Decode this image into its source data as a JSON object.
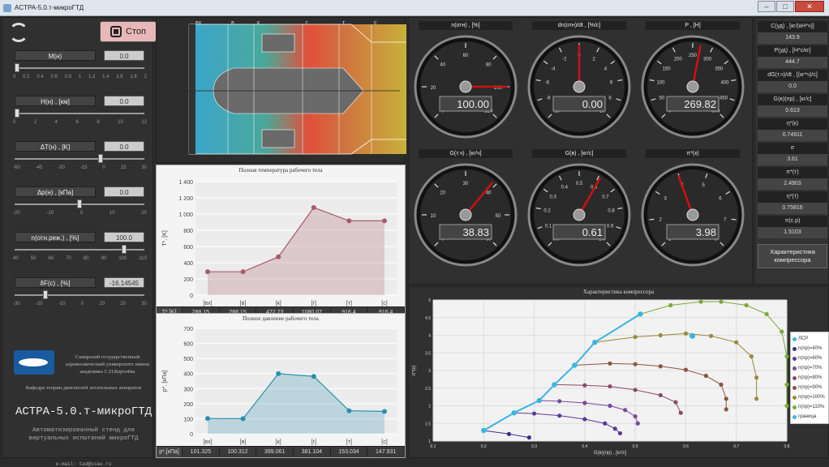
{
  "window": {
    "title": "ACTPA-5.0.т-микроГТД",
    "min": "–",
    "max": "□",
    "close": "✕"
  },
  "controls": {
    "stop_label": "Стоп"
  },
  "params": [
    {
      "label": "M(н)",
      "value": "0.0",
      "ticks": [
        "0",
        "0.2",
        "0.4",
        "0.6",
        "0.8",
        "1",
        "1.2",
        "1.4",
        "1.6",
        "1.8",
        "2"
      ],
      "pos": 0.0
    },
    {
      "label": "H(н) , [км]",
      "value": "0.0",
      "ticks": [
        "0",
        "2",
        "4",
        "6",
        "8",
        "10",
        "12"
      ],
      "pos": 0.0
    },
    {
      "label": "ΔT(н) , [K]",
      "value": "0.0",
      "ticks": [
        "-60",
        "-45",
        "-30",
        "-15",
        "0",
        "15",
        "30"
      ],
      "pos": 0.667
    },
    {
      "label": "Δp(н) , [кПа]",
      "value": "0.0",
      "ticks": [
        "-20",
        "-10",
        "0",
        "10",
        "20"
      ],
      "pos": 0.5
    },
    {
      "label": "n(отн.реж.) , [%]",
      "value": "100.0",
      "ticks": [
        "40",
        "50",
        "60",
        "70",
        "80",
        "90",
        "100",
        "110"
      ],
      "pos": 0.857
    },
    {
      "label": "δF(с) , [%]",
      "value": "-16.14545",
      "ticks": [
        "-30",
        "-20",
        "-10",
        "0",
        "10",
        "20",
        "30"
      ],
      "pos": 0.23
    }
  ],
  "branding": {
    "university": "Самарский государственный аэрокосмический университет имени академика С.П.Королёва",
    "department": "Кафедра теории двигателей летательных аппаратов",
    "app": "АСТРА-5.0.т-микроГТД",
    "description": "Автоматизированный стенд для виртуальных испытаний микроГТД",
    "email": "e-mail: tad@ssau.ru"
  },
  "engine": {
    "stations": [
      "вх",
      "в",
      "к",
      "г",
      "т",
      "с"
    ]
  },
  "temp_chart": {
    "title": "Полная температура рабочего тела",
    "row_label": "T*,[K]",
    "ylabel": "T*, [K]",
    "ylim": [
      0,
      1400
    ],
    "yticks": [
      "0",
      "200",
      "400",
      "600",
      "800",
      "1 000",
      "1 200",
      "1 400"
    ],
    "categories": [
      "[вх]",
      "[в]",
      "[к]",
      "[г]",
      "[т]",
      "[с]"
    ],
    "values": [
      288.15,
      288.15,
      472.73,
      1080.07,
      916.4,
      916.4
    ],
    "display": [
      "288.15",
      "288.15",
      "472.73",
      "1080.07",
      "916.4",
      "916.4"
    ],
    "color": "#a85a6a"
  },
  "press_chart": {
    "title": "Полное давление рабочего тела",
    "row_label": "p*,[кПа]",
    "ylabel": "p*, [кПа]",
    "ylim": [
      0,
      700
    ],
    "yticks": [
      "0",
      "100",
      "200",
      "300",
      "400",
      "500",
      "600",
      "700"
    ],
    "categories": [
      "[вх]",
      "[в]",
      "[к]",
      "[г]",
      "[т]",
      "[с]"
    ],
    "values": [
      101.325,
      100.312,
      399.061,
      381.104,
      153.034,
      147.931
    ],
    "display": [
      "101.325",
      "100.312",
      "399.061",
      "381.104",
      "153.034",
      "147.931"
    ],
    "color": "#2a8fb0"
  },
  "gauges": [
    {
      "label": "n(отн) , [%]",
      "value": "100.00",
      "min": 0,
      "max": 120,
      "v": 100,
      "ticks": [
        "0",
        "20",
        "40",
        "60",
        "80",
        "100",
        "120"
      ]
    },
    {
      "label": "dn(отн)/dt , [%/c]",
      "value": "0.00",
      "min": -10,
      "max": 10,
      "v": 0,
      "ticks": [
        "-10",
        "-8",
        "-6",
        "-4",
        "-2",
        "0",
        "2",
        "4",
        "6",
        "8",
        "10"
      ]
    },
    {
      "label": "P , [H]",
      "value": "269.82",
      "min": 0,
      "max": 500,
      "v": 269.82,
      "ticks": [
        "0",
        "50",
        "100",
        "150",
        "200",
        "250",
        "300",
        "350",
        "400",
        "450",
        "500"
      ]
    },
    {
      "label": "G(т.ч) , [кг/ч]",
      "value": "38.83",
      "min": 0,
      "max": 60,
      "v": 38.83,
      "ticks": [
        "0",
        "10",
        "20",
        "30",
        "40",
        "50",
        "60"
      ]
    },
    {
      "label": "G(в) , [кг/с]",
      "value": "0.61",
      "min": 0,
      "max": 1,
      "v": 0.61,
      "ticks": [
        "0.0",
        "0.1",
        "0.2",
        "0.3",
        "0.4",
        "0.5",
        "0.6",
        "0.7",
        "0.8",
        "0.9",
        "1.0"
      ]
    },
    {
      "label": "π*(к)",
      "value": "3.98",
      "min": 1,
      "max": 8,
      "v": 3.98,
      "ticks": [
        "1",
        "2",
        "3",
        "4",
        "5",
        "6",
        "7",
        "8"
      ]
    }
  ],
  "right_params": [
    {
      "label": "C(уд) , [кг/(кН*ч)]",
      "value": "143.9"
    },
    {
      "label": "P(уд) , [Н*с/кг]",
      "value": "444.7"
    },
    {
      "label": "dG(т.ч)/dt , [(кг*ч)/c]",
      "value": "0.0"
    },
    {
      "label": "G(в)(пр) , [кг/с]",
      "value": "0.613"
    },
    {
      "label": "η*(к)",
      "value": "0.74911"
    },
    {
      "label": "σ",
      "value": "3.61"
    },
    {
      "label": "π*(т)",
      "value": "2.4903"
    },
    {
      "label": "η*(т)",
      "value": "0.75816"
    },
    {
      "label": "π(с.р)",
      "value": "1.5103"
    }
  ],
  "char_button": "Характеристика компрессора",
  "map": {
    "title": "Характеристика компрессора",
    "xlabel": "G(в)(пр) , [кг/с]",
    "ylabel": "π*(к)",
    "xticks": [
      "0.1",
      "0.2",
      "0.3",
      "0.4",
      "0.5",
      "0.6",
      "0.7",
      "0.8"
    ],
    "yticks": [
      "1",
      "1.5",
      "2",
      "2.5",
      "3",
      "3.5",
      "4",
      "4.5",
      "5"
    ],
    "legend": [
      {
        "name": "ЛСР",
        "color": "#39b5e0"
      },
      {
        "name": "n(пр)=40%",
        "color": "#3b2f8c"
      },
      {
        "name": "n(пр)=60%",
        "color": "#5b3a9a"
      },
      {
        "name": "n(пр)=70%",
        "color": "#7a4b9a"
      },
      {
        "name": "n(пр)=80%",
        "color": "#8c4a6a"
      },
      {
        "name": "n(пр)=90%",
        "color": "#8a5540"
      },
      {
        "name": "n(пр)=100%",
        "color": "#9a8a3a"
      },
      {
        "name": "n(пр)=110%",
        "color": "#7aaa3a"
      },
      {
        "name": "граница",
        "color": "#39b5e0"
      }
    ],
    "chart_data": {
      "type": "scatter",
      "xlim": [
        0.1,
        0.8
      ],
      "ylim": [
        1,
        5
      ],
      "series": [
        {
          "name": "n(пр)=40%",
          "points": [
            [
              0.2,
              1.3
            ],
            [
              0.25,
              1.2
            ],
            [
              0.29,
              1.1
            ]
          ]
        },
        {
          "name": "n(пр)=60%",
          "points": [
            [
              0.26,
              1.8
            ],
            [
              0.3,
              1.78
            ],
            [
              0.35,
              1.72
            ],
            [
              0.4,
              1.62
            ],
            [
              0.44,
              1.5
            ],
            [
              0.46,
              1.35
            ],
            [
              0.47,
              1.22
            ]
          ]
        },
        {
          "name": "n(пр)=70%",
          "points": [
            [
              0.31,
              2.15
            ],
            [
              0.35,
              2.13
            ],
            [
              0.4,
              2.08
            ],
            [
              0.45,
              2.0
            ],
            [
              0.48,
              1.88
            ],
            [
              0.5,
              1.7
            ],
            [
              0.505,
              1.5
            ]
          ]
        },
        {
          "name": "n(пр)=80%",
          "points": [
            [
              0.34,
              2.6
            ],
            [
              0.4,
              2.58
            ],
            [
              0.45,
              2.55
            ],
            [
              0.5,
              2.45
            ],
            [
              0.55,
              2.3
            ],
            [
              0.58,
              2.1
            ],
            [
              0.59,
              1.8
            ]
          ]
        },
        {
          "name": "n(пр)=90%",
          "points": [
            [
              0.38,
              3.15
            ],
            [
              0.45,
              3.2
            ],
            [
              0.5,
              3.18
            ],
            [
              0.55,
              3.12
            ],
            [
              0.6,
              3.02
            ],
            [
              0.64,
              2.85
            ],
            [
              0.67,
              2.6
            ],
            [
              0.68,
              2.2
            ],
            [
              0.68,
              1.9
            ]
          ]
        },
        {
          "name": "n(пр)=100%",
          "points": [
            [
              0.42,
              3.8
            ],
            [
              0.5,
              3.95
            ],
            [
              0.55,
              4.0
            ],
            [
              0.6,
              4.05
            ],
            [
              0.65,
              3.98
            ],
            [
              0.7,
              3.8
            ],
            [
              0.73,
              3.4
            ],
            [
              0.74,
              2.8
            ],
            [
              0.74,
              2.2
            ]
          ]
        },
        {
          "name": "n(пр)=110%",
          "points": [
            [
              0.51,
              4.6
            ],
            [
              0.57,
              4.85
            ],
            [
              0.63,
              4.95
            ],
            [
              0.67,
              4.95
            ],
            [
              0.72,
              4.85
            ],
            [
              0.76,
              4.6
            ],
            [
              0.79,
              4.1
            ],
            [
              0.8,
              3.4
            ],
            [
              0.8,
              2.6
            ],
            [
              0.8,
              2.0
            ]
          ]
        },
        {
          "name": "граница",
          "points": [
            [
              0.2,
              1.3
            ],
            [
              0.26,
              1.8
            ],
            [
              0.31,
              2.15
            ],
            [
              0.34,
              2.6
            ],
            [
              0.38,
              3.15
            ],
            [
              0.42,
              3.8
            ],
            [
              0.51,
              4.6
            ]
          ]
        }
      ],
      "op_point": [
        0.613,
        3.98
      ]
    }
  }
}
